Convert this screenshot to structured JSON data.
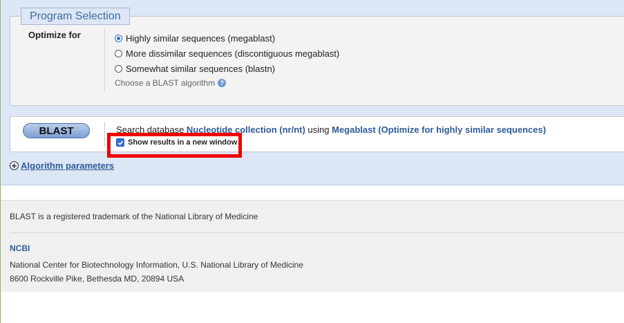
{
  "program_selection": {
    "legend": "Program Selection",
    "optimize_label": "Optimize for",
    "options": [
      {
        "label": "Highly similar sequences (megablast)",
        "checked": true
      },
      {
        "label": "More dissimilar sequences (discontiguous megablast)",
        "checked": false
      },
      {
        "label": "Somewhat similar sequences (blastn)",
        "checked": false
      }
    ],
    "hint": "Choose a BLAST algorithm"
  },
  "submit": {
    "button_label": "BLAST",
    "search_prefix": "Search database ",
    "database": "Nucleotide collection (nr/nt)",
    "using": " using ",
    "algorithm": "Megablast (Optimize for highly similar sequences)",
    "new_window_label": "Show results in a new window",
    "new_window_checked": true
  },
  "algorithm_parameters": "Algorithm parameters",
  "footer": {
    "trademark": "BLAST is a registered trademark of the National Library of Medicine",
    "ncbi": "NCBI",
    "address_line1": "National Center for Biotechnology Information, U.S. National Library of Medicine",
    "address_line2": "8600 Rockville Pike, Bethesda MD, 20894 USA"
  },
  "colors": {
    "form_bg": "#dde6f4",
    "link": "#2d5b9a",
    "highlight": "#ee0000"
  }
}
